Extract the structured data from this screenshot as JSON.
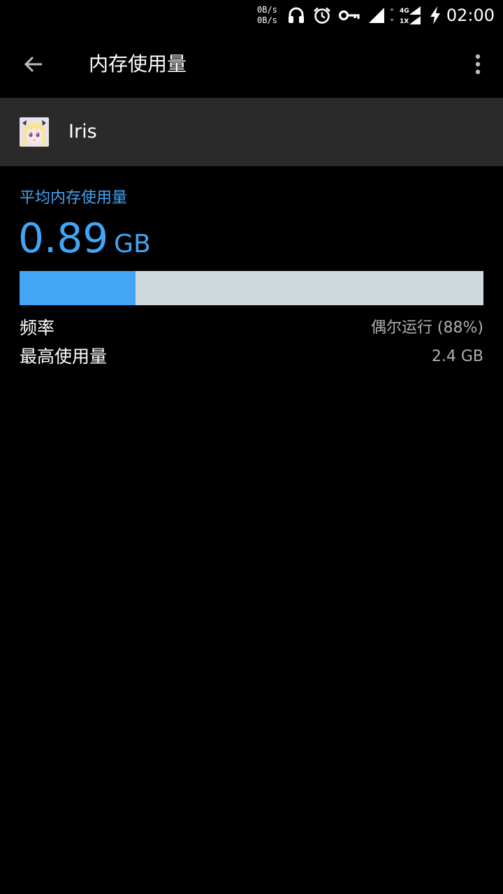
{
  "status_bar": {
    "net_speed_up": "0B/s",
    "net_speed_down": "0B/s",
    "network_type_top": "4G",
    "network_type_bottom": "1X",
    "time": "02:00",
    "icons": [
      "headset-icon",
      "alarm-icon",
      "vpn-key-icon",
      "signal-icon",
      "dual-signal-icon",
      "charging-icon"
    ]
  },
  "toolbar": {
    "back_icon": "arrow-left-icon",
    "title": "内存使用量",
    "overflow_icon": "more-vertical-icon"
  },
  "app": {
    "name": "Iris",
    "icon": "app-avatar-icon"
  },
  "memory": {
    "section_label": "平均内存使用量",
    "average_value": "0.89",
    "average_unit": "GB",
    "usage_fraction": 0.25,
    "frequency_label": "频率",
    "frequency_value": "偶尔运行 (88%)",
    "max_label": "最高使用量",
    "max_value": "2.4 GB"
  },
  "colors": {
    "accent": "#42a5f5",
    "bar_track": "#cfd8dc",
    "header_bg": "#2a2a2a",
    "background": "#000000",
    "secondary_text": "#b0b0b0"
  }
}
